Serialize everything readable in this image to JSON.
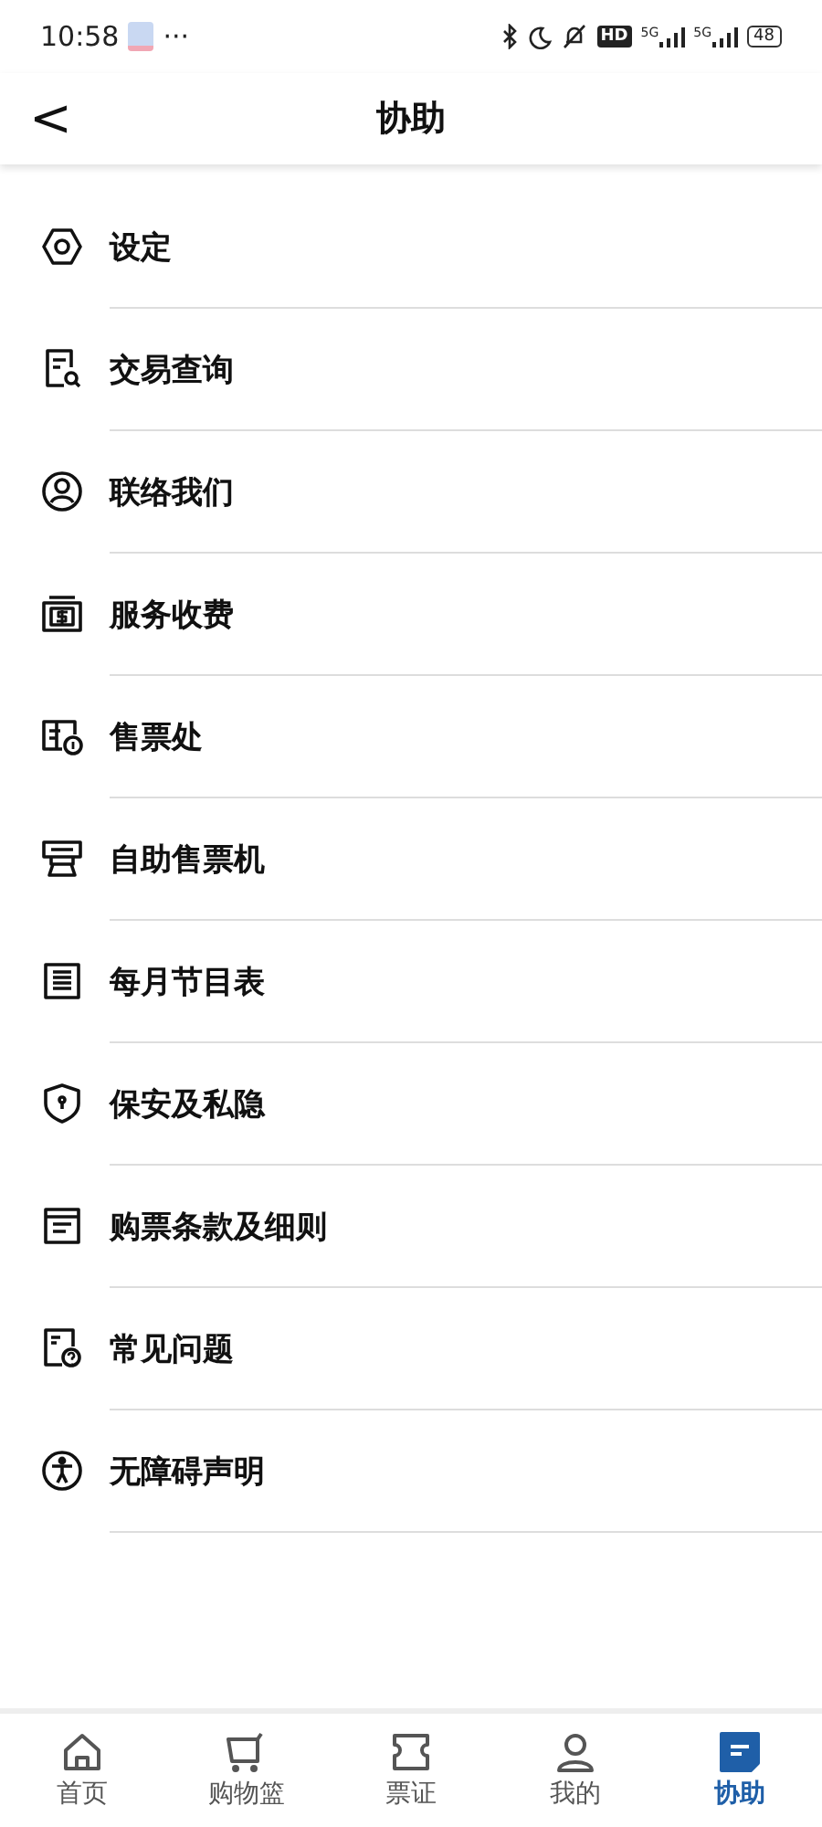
{
  "status_bar": {
    "time": "10:58",
    "more": "···",
    "hd": "HD",
    "network": [
      "5G",
      "5G"
    ],
    "battery": "48"
  },
  "header": {
    "back": "<",
    "title": "协助"
  },
  "items": [
    {
      "kind": "settings",
      "label": "设定"
    },
    {
      "kind": "search",
      "label": "交易查询"
    },
    {
      "kind": "contact",
      "label": "联络我们"
    },
    {
      "kind": "fee",
      "label": "服务收费"
    },
    {
      "kind": "office",
      "label": "售票处"
    },
    {
      "kind": "kiosk",
      "label": "自助售票机"
    },
    {
      "kind": "schedule",
      "label": "每月节目表"
    },
    {
      "kind": "security",
      "label": "保安及私隐"
    },
    {
      "kind": "terms",
      "label": "购票条款及细则"
    },
    {
      "kind": "faq",
      "label": "常见问题"
    },
    {
      "kind": "access",
      "label": "无障碍声明"
    }
  ],
  "tabs": [
    {
      "kind": "home",
      "label": "首页",
      "selected": false
    },
    {
      "kind": "cart",
      "label": "购物篮",
      "selected": false
    },
    {
      "kind": "ticket",
      "label": "票证",
      "selected": false
    },
    {
      "kind": "user",
      "label": "我的",
      "selected": false
    },
    {
      "kind": "help",
      "label": "协助",
      "selected": true
    }
  ]
}
